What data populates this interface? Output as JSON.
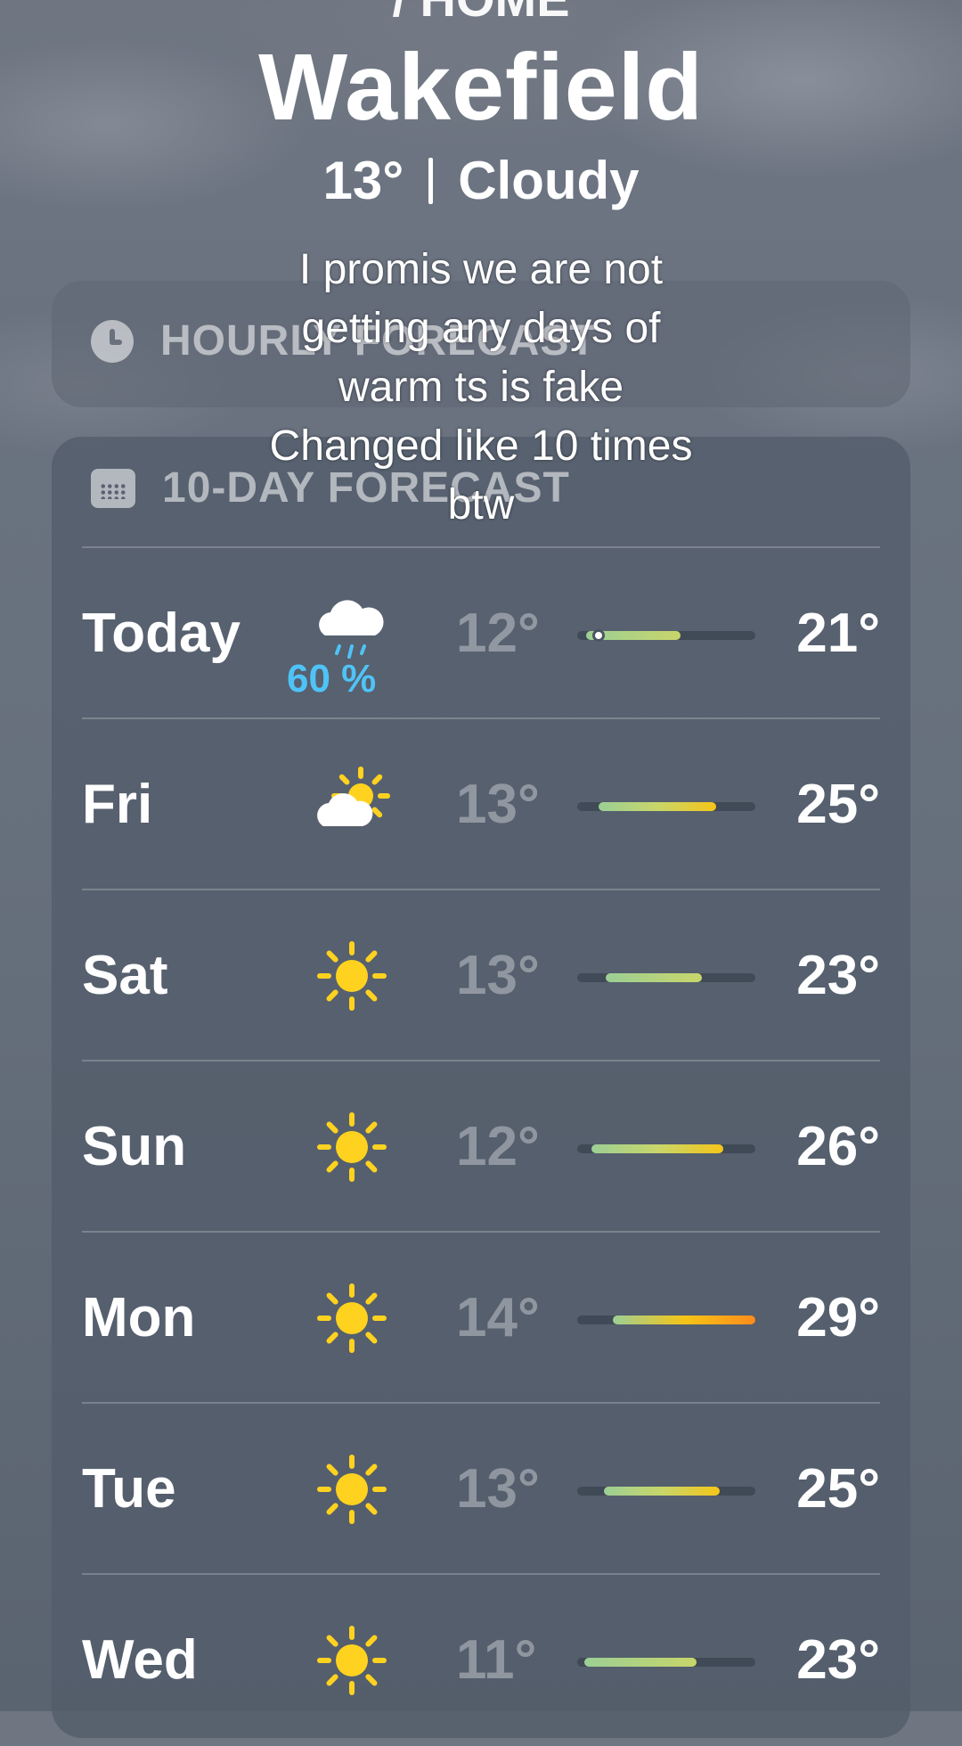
{
  "header": {
    "top_partial": "/ HOME",
    "city": "Wakefield",
    "temp": "13°",
    "condition": "Cloudy"
  },
  "hourly": {
    "label": "HOURLY FORECAST",
    "icon": "clock-icon"
  },
  "tenday": {
    "label": "10-DAY FORECAST",
    "icon": "calendar-icon",
    "range_colors": [
      "#9ccf95",
      "#c8d66a",
      "#f5c518",
      "#ff8c1a"
    ],
    "days": [
      {
        "day": "Today",
        "icon": "cloud-rain-icon",
        "pop": "60 %",
        "low": "12°",
        "high": "21°",
        "low_frac": 0.05,
        "high_frac": 0.58,
        "current_frac": 0.12
      },
      {
        "day": "Fri",
        "icon": "partly-sunny-icon",
        "pop": "",
        "low": "13°",
        "high": "25°",
        "low_frac": 0.12,
        "high_frac": 0.78
      },
      {
        "day": "Sat",
        "icon": "sun-icon",
        "pop": "",
        "low": "13°",
        "high": "23°",
        "low_frac": 0.16,
        "high_frac": 0.7
      },
      {
        "day": "Sun",
        "icon": "sun-icon",
        "pop": "",
        "low": "12°",
        "high": "26°",
        "low_frac": 0.08,
        "high_frac": 0.82
      },
      {
        "day": "Mon",
        "icon": "sun-icon",
        "pop": "",
        "low": "14°",
        "high": "29°",
        "low_frac": 0.2,
        "high_frac": 1.0
      },
      {
        "day": "Tue",
        "icon": "sun-icon",
        "pop": "",
        "low": "13°",
        "high": "25°",
        "low_frac": 0.15,
        "high_frac": 0.8
      },
      {
        "day": "Wed",
        "icon": "sun-icon",
        "pop": "",
        "low": "11°",
        "high": "23°",
        "low_frac": 0.04,
        "high_frac": 0.67
      }
    ]
  },
  "caption": {
    "lines": [
      "I promis we are not",
      "getting any days of",
      "warm ts is fake",
      "Changed like 10 times",
      "btw"
    ]
  }
}
